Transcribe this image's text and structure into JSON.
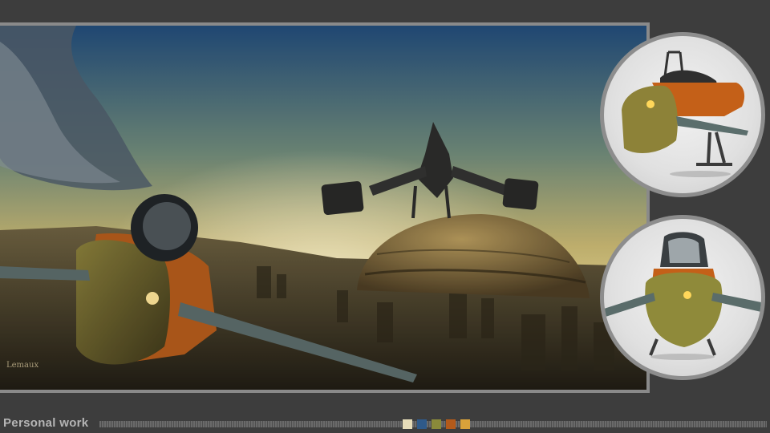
{
  "footer": {
    "label": "Personal work",
    "swatches": [
      "#e6dcb9",
      "#2f5a8a",
      "#8a8a3a",
      "#b35a1a",
      "#d8a23a"
    ]
  },
  "artwork": {
    "main": "flying-vehicle-over-city",
    "signature": "Lemaux"
  },
  "thumbnails": [
    {
      "name": "vehicle-side-view"
    },
    {
      "name": "vehicle-front-view"
    }
  ]
}
